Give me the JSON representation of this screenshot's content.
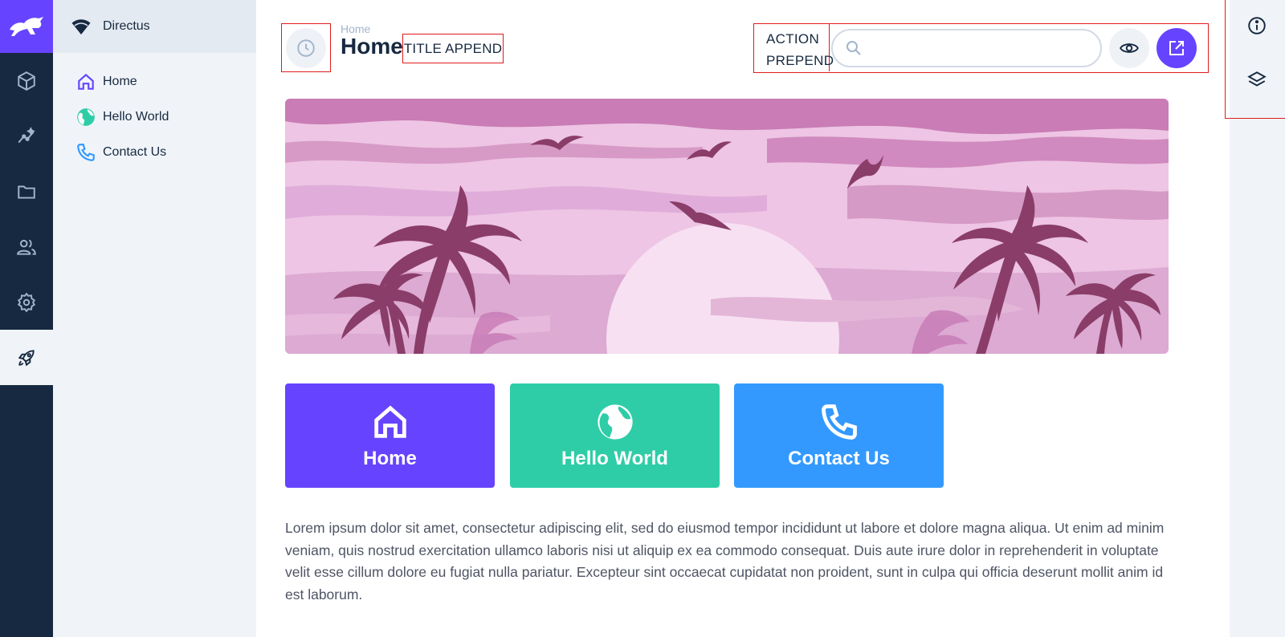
{
  "project": {
    "name": "Directus"
  },
  "modules": [
    {
      "name": "content",
      "icon": "box-icon"
    },
    {
      "name": "insights",
      "icon": "insights-icon"
    },
    {
      "name": "files",
      "icon": "folder-icon"
    },
    {
      "name": "users",
      "icon": "people-icon"
    },
    {
      "name": "settings",
      "icon": "gear-icon"
    },
    {
      "name": "pages",
      "icon": "rocket-icon",
      "active": true
    }
  ],
  "nav": {
    "items": [
      {
        "label": "Home",
        "icon": "home-icon",
        "color": "#6644ff"
      },
      {
        "label": "Hello World",
        "icon": "globe-icon",
        "color": "#2ecda7"
      },
      {
        "label": "Contact Us",
        "icon": "phone-icon",
        "color": "#3399ff"
      }
    ]
  },
  "header": {
    "breadcrumb": "Home",
    "title": "Home",
    "title_append": "TITLE APPEND",
    "action_prepend_line1": "ACTION",
    "action_prepend_line2": "PREPEND",
    "search_placeholder": "",
    "search_value": ""
  },
  "cards": [
    {
      "label": "Home",
      "icon": "home-icon",
      "color": "#6644ff"
    },
    {
      "label": "Hello World",
      "icon": "globe-icon",
      "color": "#2ecda7"
    },
    {
      "label": "Contact Us",
      "icon": "phone-icon",
      "color": "#3399ff"
    }
  ],
  "content": {
    "paragraph": "Lorem ipsum dolor sit amet, consectetur adipiscing elit, sed do eiusmod tempor incididunt ut labore et dolore magna aliqua. Ut enim ad minim veniam, quis nostrud exercitation ullamco laboris nisi ut aliquip ex ea commodo consequat. Duis aute irure dolor in reprehenderit in voluptate velit esse cillum dolore eu fugiat nulla pariatur. Excepteur sint occaecat cupidatat non proident, sunt in culpa qui officia deserunt mollit anim id est laborum."
  },
  "sidebar": {
    "items": [
      {
        "icon": "info-icon"
      },
      {
        "icon": "layers-icon"
      }
    ]
  },
  "colors": {
    "accent": "#6644ff",
    "module_bar": "#172940",
    "nav_bg": "#f0f4f9",
    "highlight_outline": "#e01b1b"
  }
}
